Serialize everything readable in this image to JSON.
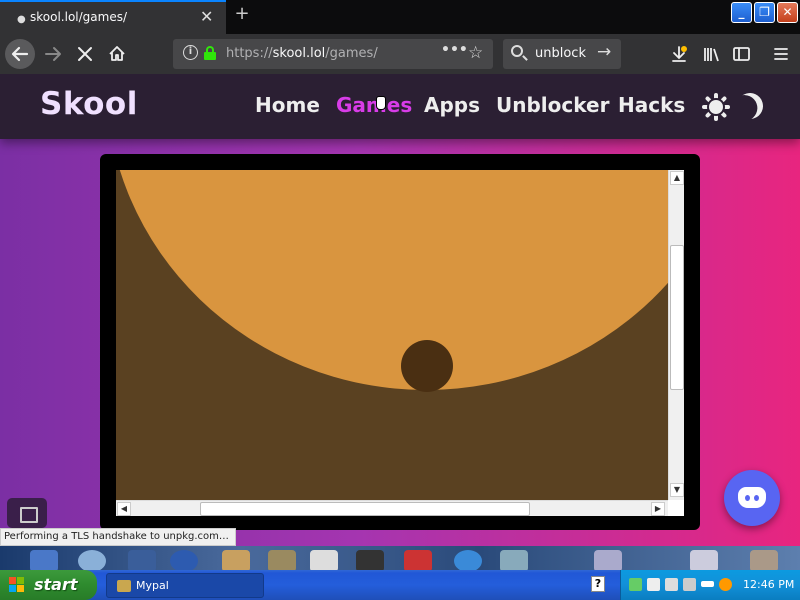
{
  "browser": {
    "tab_title": "skool.lol/games/",
    "tab_close": "✕",
    "new_tab": "+",
    "window_buttons": {
      "minimize": "_",
      "restore": "❐",
      "close": "✕"
    },
    "url_prefix": "https://",
    "url_host": "skool.lol",
    "url_path": "/games/",
    "search_query": "unblock",
    "status_message": "Performing a TLS handshake to unpkg.com…"
  },
  "site": {
    "logo": "Skool",
    "nav": [
      {
        "label": "Home"
      },
      {
        "label": "Games"
      },
      {
        "label": "Apps"
      },
      {
        "label": "Unblocker"
      },
      {
        "label": "Hacks"
      }
    ],
    "active_nav": "Games",
    "colors": {
      "header_bg": "#2b1f33",
      "active_nav": "#d83ce8",
      "gradient_left": "#7b2fa4",
      "gradient_right": "#e8257f",
      "discord": "#5865f2",
      "game_sky": "#d9953f",
      "game_ground": "#5a4121",
      "game_ball": "#4a2f12"
    }
  },
  "taskbar": {
    "start_label": "start",
    "task_item": "Mypal",
    "help_glyph": "?",
    "clock": "12:46 PM"
  }
}
